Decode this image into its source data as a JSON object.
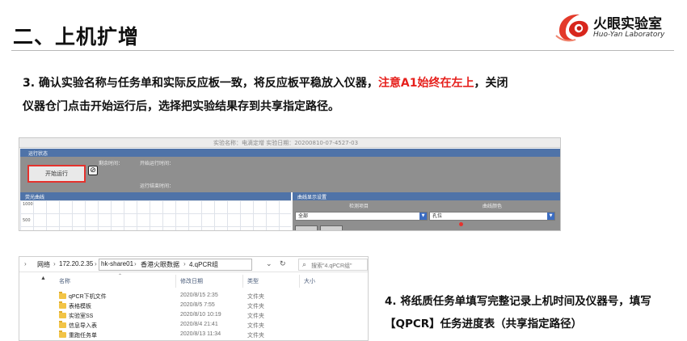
{
  "slide": {
    "title": "二、上机扩增",
    "logo_cn": "火眼实验室",
    "logo_en": "Huo-Yan Laboratory"
  },
  "step3": {
    "lead": "3. 确认实验名称与任务单和实际反应板一致，将反应板平稳放入仪器，",
    "highlight": "注意A1始终在左上",
    "tail": "，关闭",
    "line2": "仪器仓门点击开始运行后，选择把实验结果存到共享指定路径。"
  },
  "software": {
    "top_text": "实验名称：电滴定增  实验日期：20200810-07-4527-03",
    "run_panel_title": "运行状态",
    "start_button": "开始运行",
    "stop_icon": "stop-icon",
    "field_remaining": "剩余时间：",
    "field_start": "开始运行时间：",
    "field_end": "运行结束时间：",
    "curve_title": "荧光曲线",
    "y_ticks": [
      "1000",
      "500"
    ],
    "display_title": "曲线显示设置",
    "col_channel": "检测项目",
    "col_color": "曲线颜色",
    "channel_value": "全部",
    "color_value": "孔位"
  },
  "explorer": {
    "breadcrumb": [
      "网络",
      "172.20.2.35",
      "hk-share01",
      "香港火眼数据",
      "4.qPCR组"
    ],
    "search_placeholder": "搜索\"4.qPCR组\"",
    "columns": [
      "名称",
      "修改日期",
      "类型",
      "大小"
    ],
    "rows": [
      {
        "name": "qPCR下机文件",
        "date": "2020/8/15 2:35",
        "type": "文件夹"
      },
      {
        "name": "表格模板",
        "date": "2020/8/5 7:55",
        "type": "文件夹"
      },
      {
        "name": "实验室SS",
        "date": "2020/8/10 10:19",
        "type": "文件夹"
      },
      {
        "name": "信息导入表",
        "date": "2020/8/4 21:41",
        "type": "文件夹"
      },
      {
        "name": "重跑任务单",
        "date": "2020/8/13 11:34",
        "type": "文件夹"
      }
    ]
  },
  "step4": {
    "line1": "4. 将纸质任务单填写完整记录上机时间及仪器号，填写",
    "line2": "【QPCR】任务进度表（共享指定路径）"
  },
  "colors": {
    "highlight_red": "#e6201c",
    "panel_blue": "#4f73a8",
    "panel_gray": "#8f8f8f",
    "folder_yellow": "#f2c447"
  }
}
